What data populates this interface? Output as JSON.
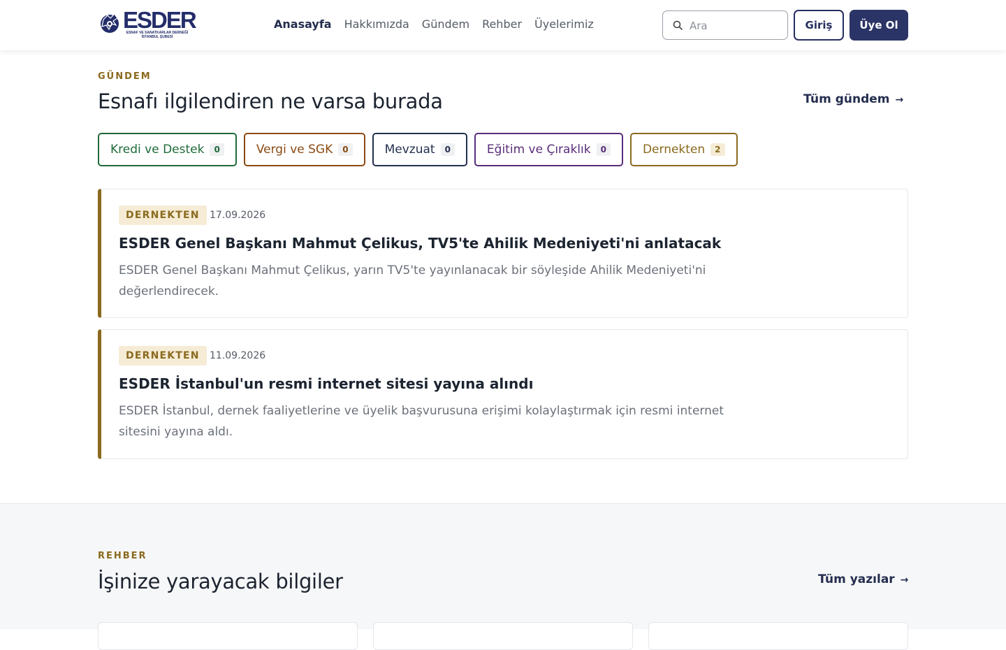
{
  "header": {
    "logo": {
      "wordmark": "ESDER",
      "subtitle_line1": "ESNAF VE SANATKARLAR DERNEĞİ",
      "subtitle_line2": "İSTANBUL ŞUBESİ"
    },
    "nav": [
      {
        "label": "Anasayfa",
        "active": true
      },
      {
        "label": "Hakkımızda",
        "active": false
      },
      {
        "label": "Gündem",
        "active": false
      },
      {
        "label": "Rehber",
        "active": false
      },
      {
        "label": "Üyelerimiz",
        "active": false
      }
    ],
    "search": {
      "placeholder": "Ara",
      "value": "",
      "icon": "search-icon"
    },
    "login_label": "Giriş",
    "join_label": "Üye Ol"
  },
  "gundem": {
    "eyebrow": "GÜNDEM",
    "title": "Esnafı ilgilendiren ne varsa burada",
    "see_all": "Tüm gündem",
    "see_all_arrow": "→",
    "categories": [
      {
        "label": "Kredi ve Destek",
        "count": "0",
        "color": "#1f6b3a"
      },
      {
        "label": "Vergi ve SGK",
        "count": "0",
        "color": "#8a4a12"
      },
      {
        "label": "Mevzuat",
        "count": "0",
        "color": "#243050"
      },
      {
        "label": "Eğitim ve Çıraklık",
        "count": "0",
        "color": "#5a2d7a"
      },
      {
        "label": "Dernekten",
        "count": "2",
        "color": "#8a6a1e"
      }
    ],
    "posts": [
      {
        "category": "DERNEKTEN",
        "date": "17.09.2026",
        "title": "ESDER Genel Başkanı Mahmut Çelikus, TV5'te Ahilik Medeniyeti'ni anlatacak",
        "description": "ESDER Genel Başkanı Mahmut Çelikus, yarın TV5'te yayınlanacak bir söyleşide Ahilik Medeniyeti'ni değerlendirecek."
      },
      {
        "category": "DERNEKTEN",
        "date": "11.09.2026",
        "title": "ESDER İstanbul'un resmi internet sitesi yayına alındı",
        "description": "ESDER İstanbul, dernek faaliyetlerine ve üyelik başvurusuna erişimi kolaylaştırmak için resmi internet sitesini yayına aldı."
      }
    ]
  },
  "rehber": {
    "eyebrow": "REHBER",
    "title": "İşinize yarayacak bilgiler",
    "see_all": "Tüm yazılar",
    "see_all_arrow": "→"
  },
  "colors": {
    "primary": "#2b3466",
    "accent": "#8a6a1e",
    "badge_bg": "#f6ecd6"
  }
}
